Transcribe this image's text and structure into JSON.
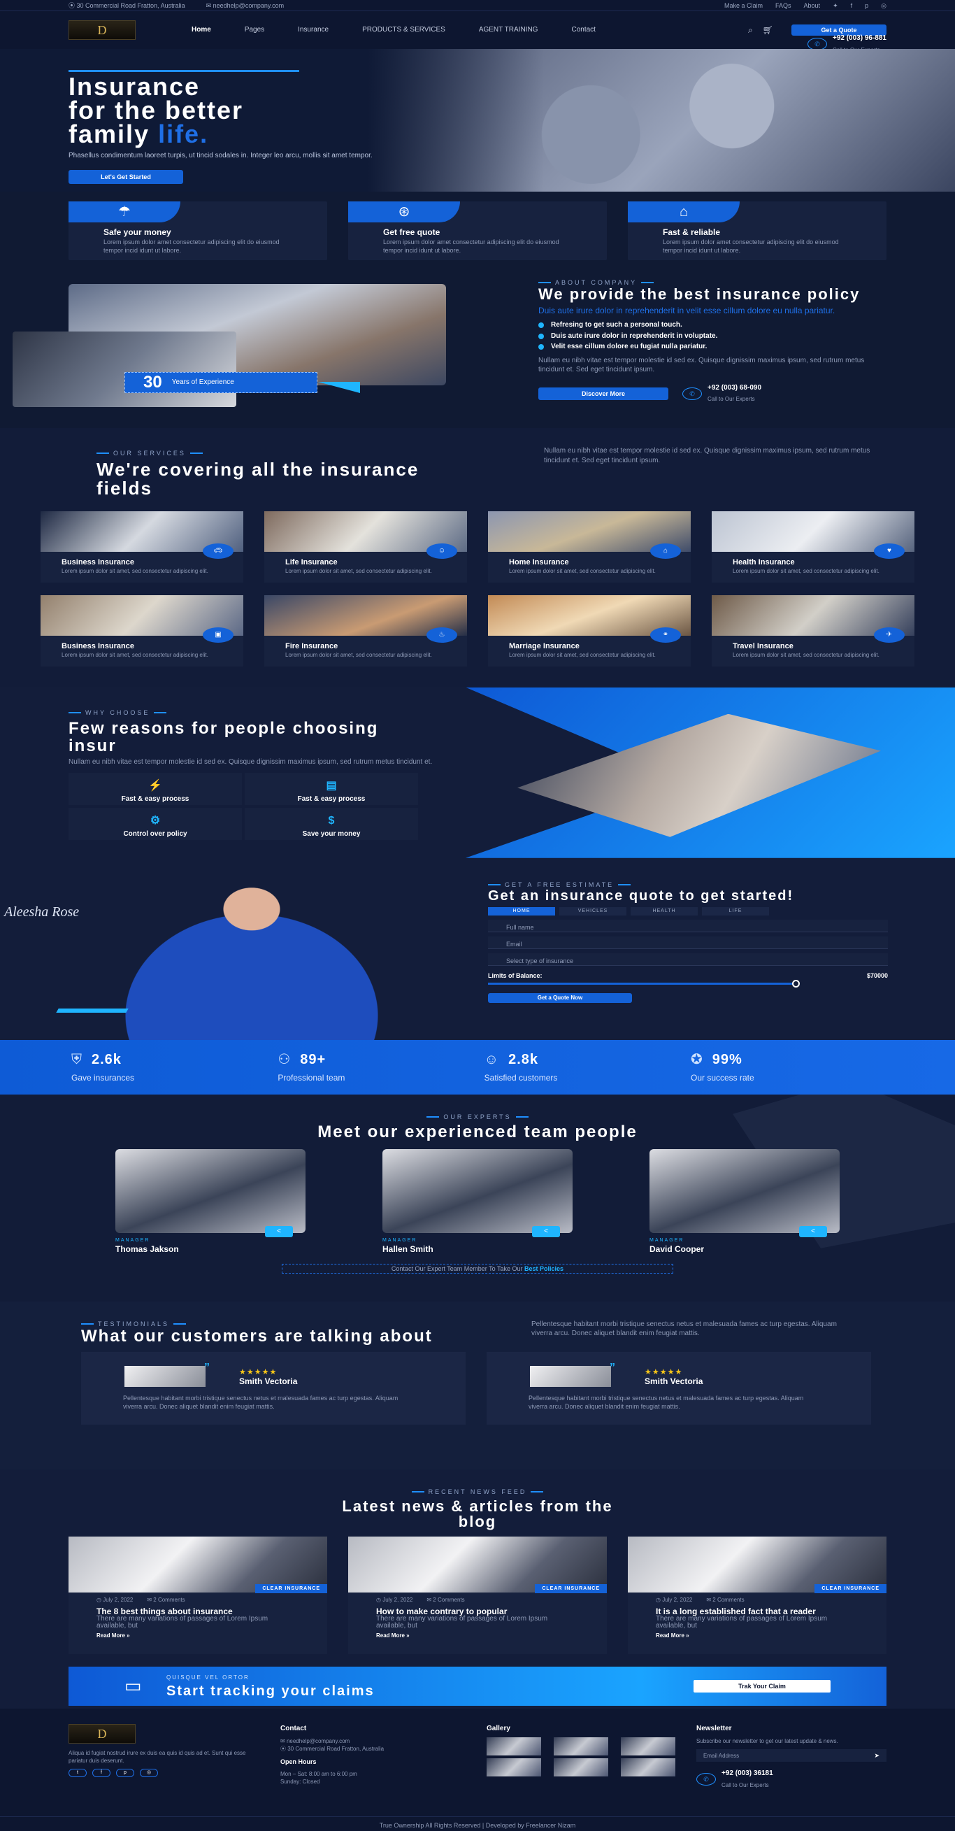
{
  "topbar": {
    "address": "30 Commercial Road Fratton, Australia",
    "email": "needhelp@company.com",
    "links": [
      "Make a Claim",
      "FAQs",
      "About"
    ],
    "social_icons": [
      "twitter-icon",
      "facebook-icon",
      "pinterest-icon",
      "instagram-icon"
    ]
  },
  "header": {
    "logo": "D",
    "nav": [
      "Home",
      "Pages",
      "Insurance",
      "PRODUCTS & SERVICES",
      "AGENT TRAINING",
      "Contact"
    ],
    "quote_button": "Get a Quote",
    "phone": "+92 (003) 96-881",
    "phone_caption": "Call to Our Experts"
  },
  "hero": {
    "title_line1": "Insurance",
    "title_line2": "for the better",
    "title_line3": "family",
    "title_highlight": "life.",
    "text": "Phasellus condimentum laoreet turpis, ut tincid sodales in. Integer leo arcu, mollis sit amet tempor.",
    "button": "Let's Get Started"
  },
  "features": [
    {
      "title": "Safe your money",
      "text": "Lorem ipsum dolor amet consectetur adipiscing elit do eiusmod tempor incid idunt ut labore."
    },
    {
      "title": "Get free quote",
      "text": "Lorem ipsum dolor amet consectetur adipiscing elit do eiusmod tempor incid idunt ut labore."
    },
    {
      "title": "Fast & reliable",
      "text": "Lorem ipsum dolor amet consectetur adipiscing elit do eiusmod tempor incid idunt ut labore."
    }
  ],
  "about": {
    "years": "30",
    "years_label": "Years of Experience",
    "subtitle": "ABOUT COMPANY",
    "title": "We provide the best insurance policy",
    "lead": "Duis aute irure dolor in reprehenderit in velit esse cillum dolore eu nulla pariatur.",
    "points": [
      "Refresing to get such a personal touch.",
      "Duis aute irure dolor in reprehenderit in voluptate.",
      "Velit esse cillum dolore eu fugiat nulla pariatur."
    ],
    "body": "Nullam eu nibh vitae est tempor molestie id sed ex. Quisque dignissim maximus ipsum, sed rutrum metus tincidunt et. Sed eget tincidunt ipsum.",
    "button": "Discover More",
    "phone": "+92 (003) 68-090",
    "phone_caption": "Call to Our Experts"
  },
  "services": {
    "subtitle": "OUR SERVICES",
    "title": "We're covering all the insurance fields",
    "text": "Nullam eu nibh vitae est tempor molestie id sed ex. Quisque dignissim maximus ipsum, sed rutrum metus tincidunt et. Sed eget tincidunt ipsum.",
    "items": [
      {
        "title": "Business Insurance",
        "text": "Lorem ipsum dolor sit amet, sed consectetur adipiscing elit."
      },
      {
        "title": "Life Insurance",
        "text": "Lorem ipsum dolor sit amet, sed consectetur adipiscing elit."
      },
      {
        "title": "Home Insurance",
        "text": "Lorem ipsum dolor sit amet, sed consectetur adipiscing elit."
      },
      {
        "title": "Health Insurance",
        "text": "Lorem ipsum dolor sit amet, sed consectetur adipiscing elit."
      },
      {
        "title": "Business Insurance",
        "text": "Lorem ipsum dolor sit amet, sed consectetur adipiscing elit."
      },
      {
        "title": "Fire Insurance",
        "text": "Lorem ipsum dolor sit amet, sed consectetur adipiscing elit."
      },
      {
        "title": "Marriage Insurance",
        "text": "Lorem ipsum dolor sit amet, sed consectetur adipiscing elit."
      },
      {
        "title": "Travel Insurance",
        "text": "Lorem ipsum dolor sit amet, sed consectetur adipiscing elit."
      }
    ]
  },
  "why": {
    "subtitle": "WHY CHOOSE",
    "title": "Few reasons for people choosing insur",
    "text": "Nullam eu nibh vitae est tempor molestie id sed ex. Quisque dignissim maximus ipsum, sed rutrum metus tincidunt et.",
    "items": [
      "Fast & easy process",
      "Fast & easy process",
      "Control over policy",
      "Save your money"
    ]
  },
  "quote": {
    "signature": "Aleesha Rose",
    "subtitle": "GET A FREE ESTIMATE",
    "title": "Get an insurance quote to get started!",
    "tabs": [
      "HOME",
      "VEHICLES",
      "HEALTH",
      "LIFE"
    ],
    "name_placeholder": "Full name",
    "email_placeholder": "Email",
    "select_placeholder": "Select type of insurance",
    "limit_label": "Limits of Balance:",
    "limit_value": "$70000",
    "limit_fraction": 1,
    "button": "Get a Quote Now"
  },
  "stats": [
    {
      "value": "2.6k",
      "label": "Gave insurances"
    },
    {
      "value": "89+",
      "label": "Professional team"
    },
    {
      "value": "2.8k",
      "label": "Satisfied customers"
    },
    {
      "value": "99%",
      "label": "Our success rate"
    }
  ],
  "team": {
    "subtitle": "OUR EXPERTS",
    "title": "Meet our experienced team people",
    "members": [
      {
        "role": "MANAGER",
        "name": "Thomas Jakson"
      },
      {
        "role": "MANAGER",
        "name": "Hallen Smith"
      },
      {
        "role": "MANAGER",
        "name": "David Cooper"
      }
    ],
    "cta_text": "Contact Our Expert Team Member To Take Our",
    "cta_link": "Best Policies"
  },
  "testimonials": {
    "subtitle": "TESTIMONIALS",
    "title": "What our customers are talking about",
    "text": "Pellentesque habitant morbi tristique senectus netus et malesuada fames ac turp egestas. Aliquam viverra arcu. Donec aliquet blandit enim feugiat mattis.",
    "items": [
      {
        "stars": "★★★★★",
        "name": "Smith Vectoria",
        "text": "Pellentesque habitant morbi tristique senectus netus et malesuada fames ac turp egestas. Aliquam viverra arcu. Donec aliquet blandit enim feugiat mattis."
      },
      {
        "stars": "★★★★★",
        "name": "Smith Vectoria",
        "text": "Pellentesque habitant morbi tristique senectus netus et malesuada fames ac turp egestas. Aliquam viverra arcu. Donec aliquet blandit enim feugiat mattis."
      }
    ]
  },
  "blog": {
    "subtitle": "RECENT NEWS FEED",
    "title": "Latest news & articles from the blog",
    "posts": [
      {
        "tag": "CLEAR INSURANCE",
        "date": "July 2, 2022",
        "comments": "2 Comments",
        "title": "The 8 best things about insurance",
        "text": "There are many variations of passages of Lorem Ipsum available, but",
        "more": "Read More »"
      },
      {
        "tag": "CLEAR INSURANCE",
        "date": "July 2, 2022",
        "comments": "2 Comments",
        "title": "How to make contrary to popular",
        "text": "There are many variations of passages of Lorem Ipsum available, but",
        "more": "Read More »"
      },
      {
        "tag": "CLEAR INSURANCE",
        "date": "July 2, 2022",
        "comments": "2 Comments",
        "title": "It is a long established fact that a reader",
        "text": "There are many variations of passages of Lorem Ipsum available, but",
        "more": "Read More »"
      }
    ]
  },
  "tracking": {
    "subtitle": "QUISQUE VEL ORTOR",
    "title": "Start tracking your claims",
    "button": "Trak Your Claim"
  },
  "footer": {
    "about": "Aliqua id fugiat nostrud irure ex duis ea quis id quis ad et. Sunt qui esse pariatur duis deserunt.",
    "contact_title": "Contact",
    "email": "needhelp@company.com",
    "address": "30 Commercial Road Fratton, Australia",
    "hours_title": "Open Hours",
    "hours": "Mon – Sat: 8:00 am to 6:00 pm",
    "hours2": "Sunday: Closed",
    "gallery_title": "Gallery",
    "newsletter_title": "Newsletter",
    "newsletter_text": "Subscribe our newsletter to get our latest update & news.",
    "email_placeholder": "Email Address",
    "phone": "+92 (003) 36181",
    "phone_caption": "Call to Our Experts",
    "copyright": "True Ownership All Rights Reserved | Developed by Freelancer Nizam"
  }
}
